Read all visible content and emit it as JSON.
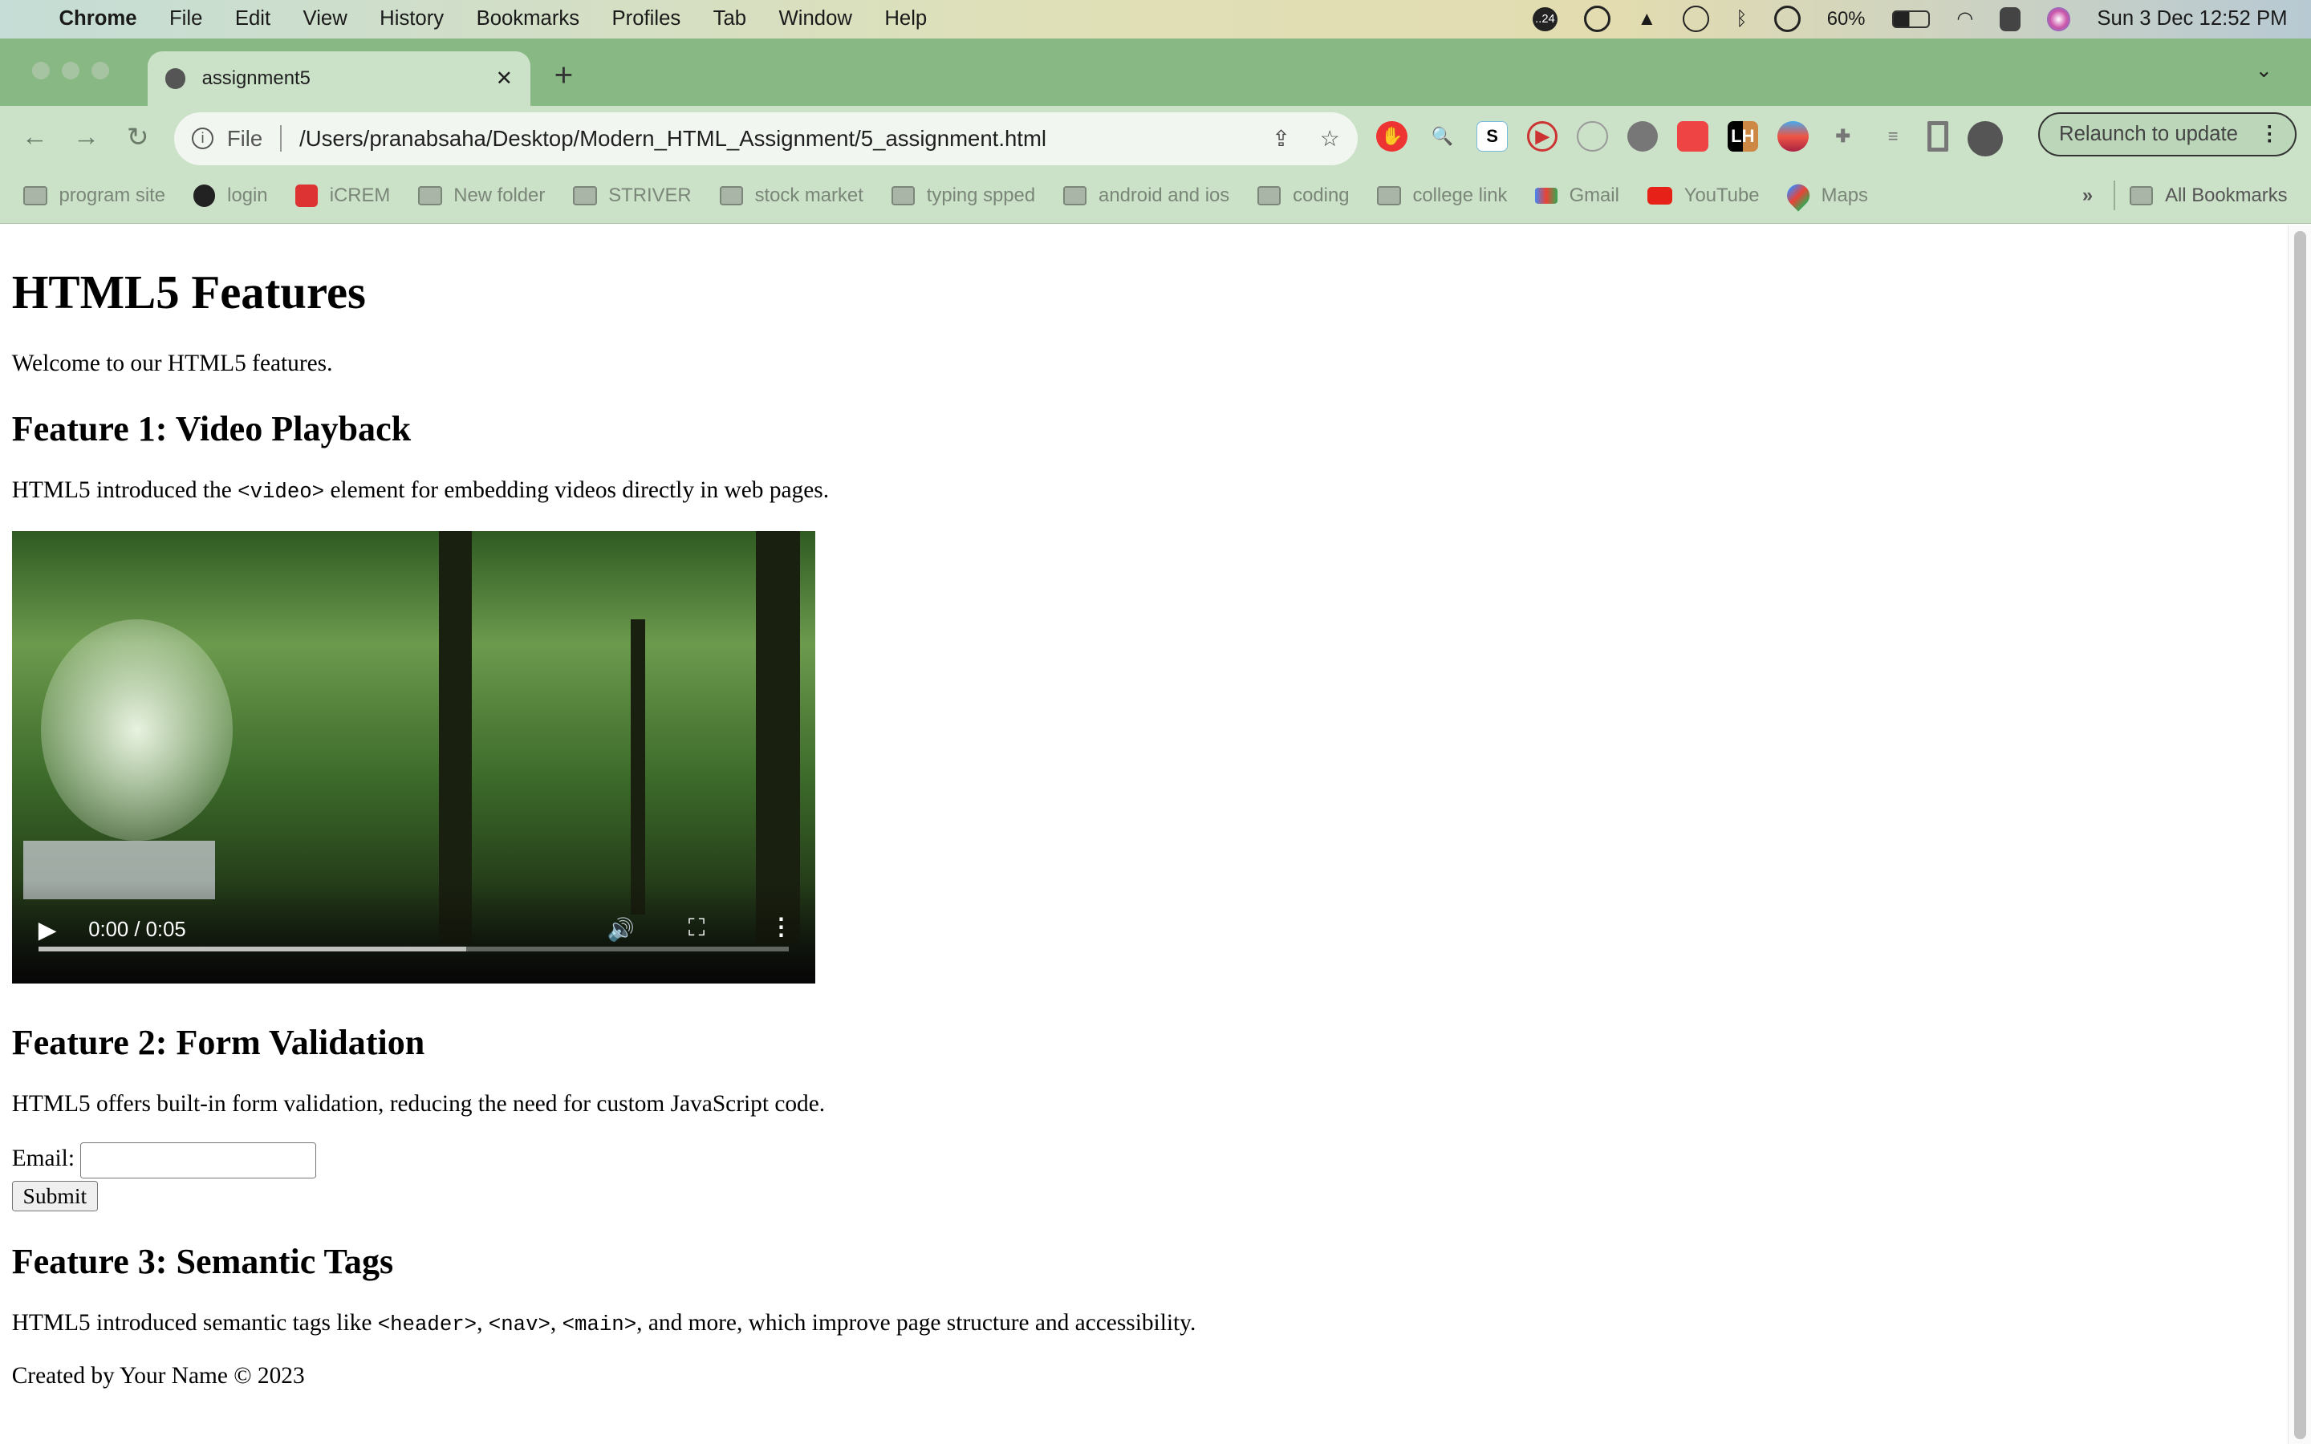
{
  "menubar": {
    "app": "Chrome",
    "items": [
      "File",
      "Edit",
      "View",
      "History",
      "Bookmarks",
      "Profiles",
      "Tab",
      "Window",
      "Help"
    ],
    "battery": "60%",
    "clock": "Sun 3 Dec  12:52 PM",
    "badge": "..24"
  },
  "tab": {
    "title": "assignment5"
  },
  "omnibox": {
    "scheme": "File",
    "url": "/Users/pranabsaha/Desktop/Modern_HTML_Assignment/5_assignment.html"
  },
  "toolbar": {
    "relaunch": "Relaunch to update"
  },
  "bookmarks": {
    "items": [
      "program site",
      "login",
      "iCREM",
      "New folder",
      "STRIVER",
      "stock market",
      "typing spped",
      "android and ios",
      "coding",
      "college link",
      "Gmail",
      "YouTube",
      "Maps"
    ],
    "more": "»",
    "all": "All Bookmarks"
  },
  "page": {
    "title": "HTML5 Features",
    "welcome": "Welcome to our HTML5 features.",
    "f1": {
      "heading": "Feature 1: Video Playback",
      "text_a": "HTML5 introduced the ",
      "code": "<video>",
      "text_b": " element for embedding videos directly in web pages."
    },
    "video": {
      "time": "0:00 / 0:05",
      "buffered": 0.57,
      "played": 0
    },
    "f2": {
      "heading": "Feature 2: Form Validation",
      "text": "HTML5 offers built-in form validation, reducing the need for custom JavaScript code.",
      "email_label": "Email:",
      "email_value": "",
      "submit": "Submit"
    },
    "f3": {
      "heading": "Feature 3: Semantic Tags",
      "t1": "HTML5 introduced semantic tags like ",
      "c1": "<header>",
      "t2": ", ",
      "c2": "<nav>",
      "t3": ", ",
      "c3": "<main>",
      "t4": ", and more, which improve page structure and accessibility."
    },
    "footer": "Created by Your Name © 2023"
  }
}
